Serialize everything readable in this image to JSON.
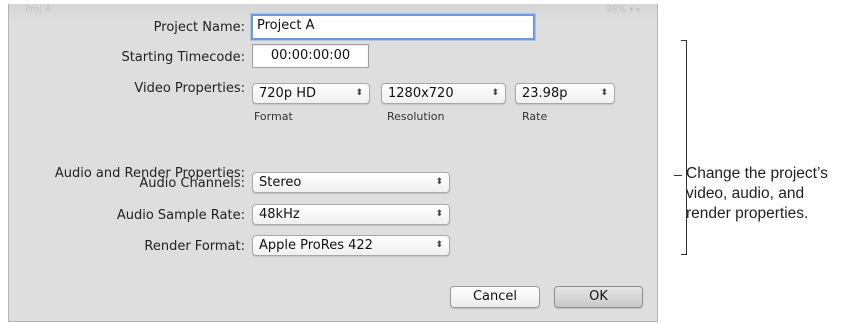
{
  "window": {
    "ghost_title_left": "Proj A",
    "ghost_title_right": "98% ▾ ▸"
  },
  "dialog": {
    "project_name": {
      "label": "Project Name:",
      "value": "Project A"
    },
    "starting_timecode": {
      "label": "Starting Timecode:",
      "value": "00:00:00:00"
    },
    "video_properties": {
      "label": "Video Properties:",
      "format": {
        "value": "720p HD",
        "caption": "Format"
      },
      "resolution": {
        "value": "1280x720",
        "caption": "Resolution"
      },
      "rate": {
        "value": "23.98p",
        "caption": "Rate"
      }
    },
    "audio_render_header": "Audio and Render Properties:",
    "audio_channels": {
      "label": "Audio Channels:",
      "value": "Stereo"
    },
    "audio_sample_rate": {
      "label": "Audio Sample Rate:",
      "value": "48kHz"
    },
    "render_format": {
      "label": "Render Format:",
      "value": "Apple ProRes 422"
    },
    "buttons": {
      "cancel": "Cancel",
      "ok": "OK"
    }
  },
  "callout": {
    "line1": "Change the project’s",
    "line2": "video, audio, and",
    "line3": "render properties."
  },
  "icons": {
    "popup_arrows": "up-down-chevron-icon"
  }
}
